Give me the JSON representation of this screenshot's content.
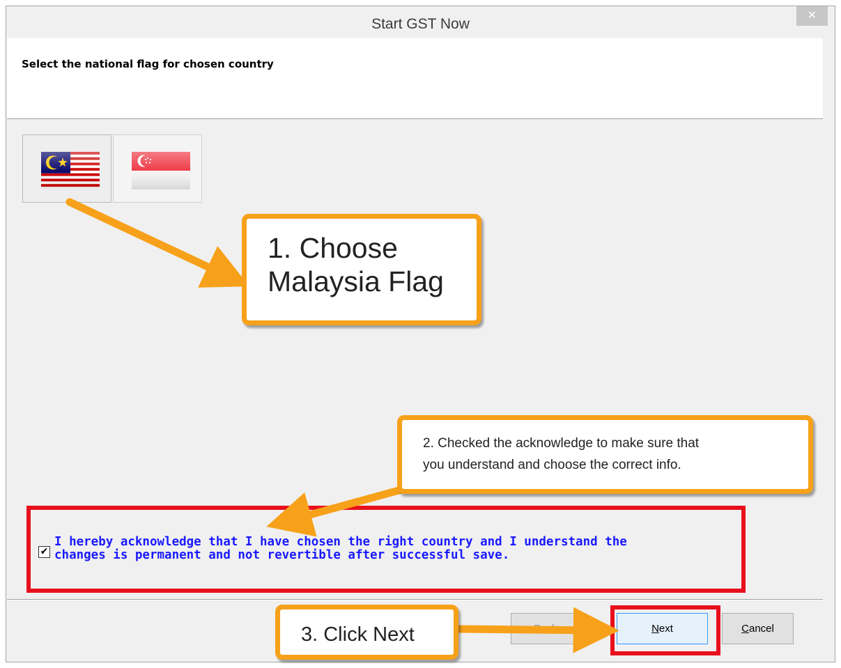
{
  "window": {
    "title": "Start GST Now",
    "close_label": "✕"
  },
  "header": {
    "instruction": "Select the national flag for chosen country"
  },
  "flags": [
    {
      "country": "Malaysia",
      "icon": "malaysia-flag-icon",
      "selected": true
    },
    {
      "country": "Singapore",
      "icon": "singapore-flag-icon",
      "selected": false
    }
  ],
  "acknowledge": {
    "checked": true,
    "check_glyph": "✔",
    "text": "I hereby acknowledge that I have chosen the right country and I understand the\nchanges is permanent and not revertible after successful save."
  },
  "buttons": {
    "back_label": "Back",
    "next_label": "Next",
    "cancel_label": "Cancel"
  },
  "annotations": {
    "step1": "1. Choose\nMalaysia Flag",
    "step2": "2. Checked the acknowledge to make sure that\nyou understand and choose the correct info.",
    "step3": "3. Click Next"
  },
  "colors": {
    "callout_border": "#f7a11a",
    "highlight_red": "#e8101d",
    "ack_text": "#1a1aff"
  }
}
